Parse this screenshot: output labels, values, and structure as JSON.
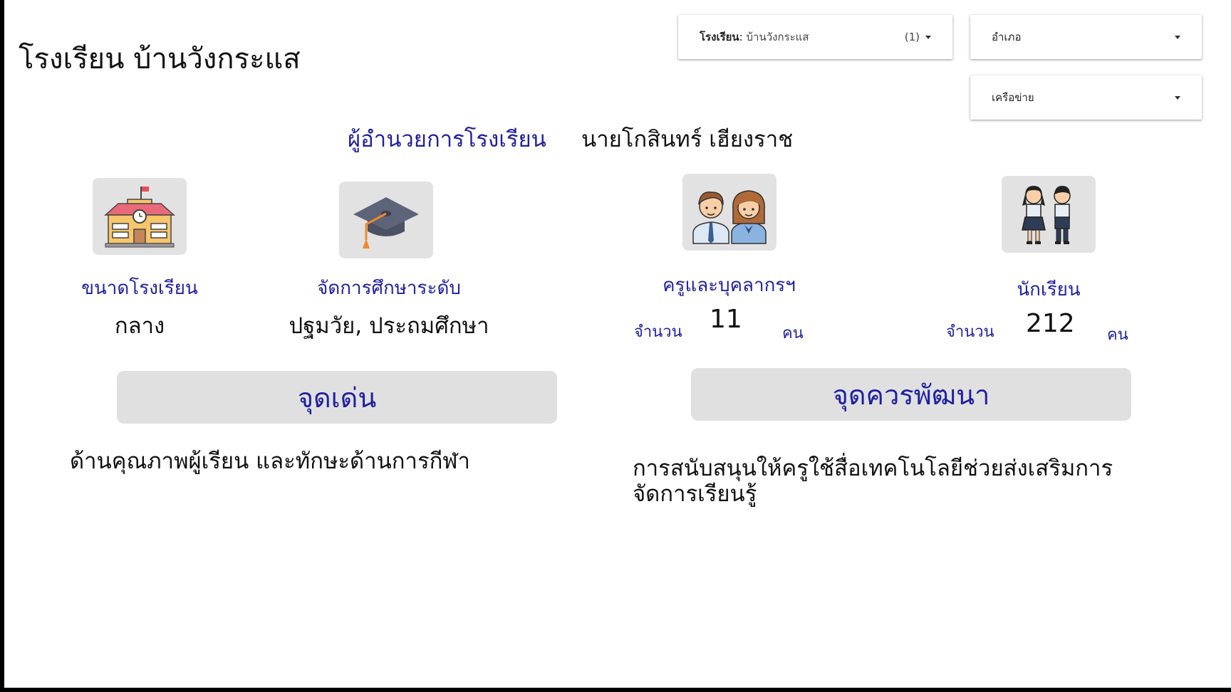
{
  "page": {
    "title": "โรงเรียน บ้านวังกระแส"
  },
  "filters": {
    "school": {
      "label": "โรงเรียน",
      "separator": ": ",
      "value": "บ้านวังกระแส",
      "count": "(1)"
    },
    "district": {
      "label": "อำเภอ"
    },
    "network": {
      "label": "เครือข่าย"
    }
  },
  "director": {
    "label": "ผู้อำนวยการโรงเรียน",
    "name": "นายโกสินทร์ เฮียงราช"
  },
  "stats": {
    "size": {
      "label": "ขนาดโรงเรียน",
      "value": "กลาง",
      "icon": "school-building-icon"
    },
    "level": {
      "label": "จัดการศึกษาระดับ",
      "value": "ปฐมวัย, ประถมศึกษา",
      "icon": "graduation-cap-icon"
    },
    "teachers": {
      "label": "ครูและบุคลากรฯ",
      "prefix": "จำนวน",
      "count": "11",
      "unit": "คน",
      "icon": "teachers-icon"
    },
    "students": {
      "label": "นักเรียน",
      "prefix": "จำนวน",
      "count": "212",
      "unit": "คน",
      "icon": "students-icon"
    }
  },
  "strengths": {
    "button_label": "จุดเด่น",
    "text": "ด้านคุณภาพผู้เรียน และทักษะด้านการกีฬา"
  },
  "improvements": {
    "button_label": "จุดควรพัฒนา",
    "text_line1": "การสนับสนุนให้ครูใช้สื่อเทคโนโลยีช่วยส่งเสริมการ",
    "text_line2": "จัดการเรียนรู้"
  },
  "colors": {
    "accent": "#1f1fa0",
    "panel": "#e0e0e0",
    "frame": "#000000"
  }
}
